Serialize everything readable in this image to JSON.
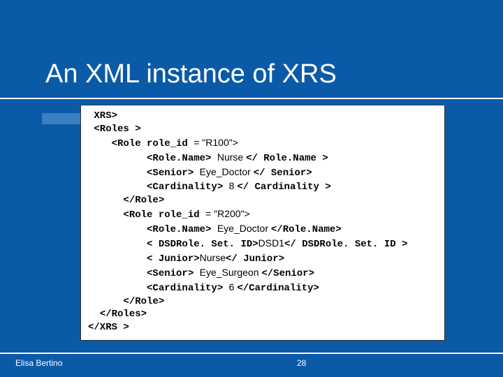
{
  "title": "An XML instance of XRS",
  "author": "Elisa Bertino",
  "page_number": "28",
  "code": {
    "l1": "XRS>",
    "l2": "<Roles >",
    "l3a": "<Role role_id ",
    "l3b": "= \"R100\">",
    "l4a": "<Role.Name> ",
    "l4b": "Nurse ",
    "l4c": "</ Role.Name >",
    "l5a": "<Senior> ",
    "l5b": "Eye_Doctor ",
    "l5c": "</ Senior>",
    "l6a": "<Cardinality> ",
    "l6b": "8 ",
    "l6c": "</ Cardinality >",
    "l7": "</Role>",
    "l8a": "<Role role_id ",
    "l8b": "= \"R200\">",
    "l9a": "<Role.Name> ",
    "l9b": "Eye_Doctor ",
    "l9c": "</Role.Name>",
    "l10a": "< DSDRole. Set. ID>",
    "l10b": "DSD1",
    "l10c": "</ DSDRole. Set. ID >",
    "l11a": "< Junior>",
    "l11b": "Nurse",
    "l11c": "</ Junior>",
    "l12a": "<Senior> ",
    "l12b": "Eye_Surgeon ",
    "l12c": "</Senior>",
    "l13a": "<Cardinality> ",
    "l13b": "6 ",
    "l13c": "</Cardinality>",
    "l14": "</Role>",
    "l15": "</Roles>",
    "l16": "</XRS >"
  }
}
